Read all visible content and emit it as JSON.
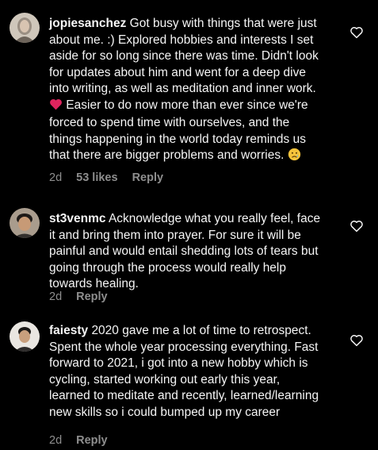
{
  "comments": [
    {
      "username": "jopiesanchez",
      "text_before_heart": "Got busy with things that were just about me. :) Explored hobbies and interests I set aside for so long since there was time. Didn't look for updates about him and went for a deep dive into writing, as well as meditation and inner work.",
      "text_after_heart": " Easier to do now more than ever since we're forced to spend time with ourselves, and the things happening in the world today reminds us that there are bigger problems and worries.",
      "time": "2d",
      "likes": "53 likes",
      "reply": "Reply"
    },
    {
      "username": "st3venmc",
      "text": "Acknowledge what you really feel, face it and bring them into prayer. For sure it will be painful and would entail shedding lots of tears but going through the process would really help towards healing.",
      "time": "2d",
      "reply": "Reply"
    },
    {
      "username": "faiesty",
      "text": "2020 gave me a lot of time to retrospect. Spent the whole year processing everything. Fast forward to 2021, i got into a new hobby which is cycling, started working out early this year, learned to meditate and recently, learned/learning new skills so i could bumped up my career",
      "time": "2d",
      "reply": "Reply"
    }
  ],
  "icons": {
    "like": "heart-outline-icon",
    "inline_heart": "red-heart-emoji-icon",
    "sad_face": "sad-face-emoji-icon"
  },
  "colors": {
    "background": "#000000",
    "text": "#f5f5f5",
    "meta": "#8e8e8e",
    "heart_emoji": "#e0245e"
  }
}
